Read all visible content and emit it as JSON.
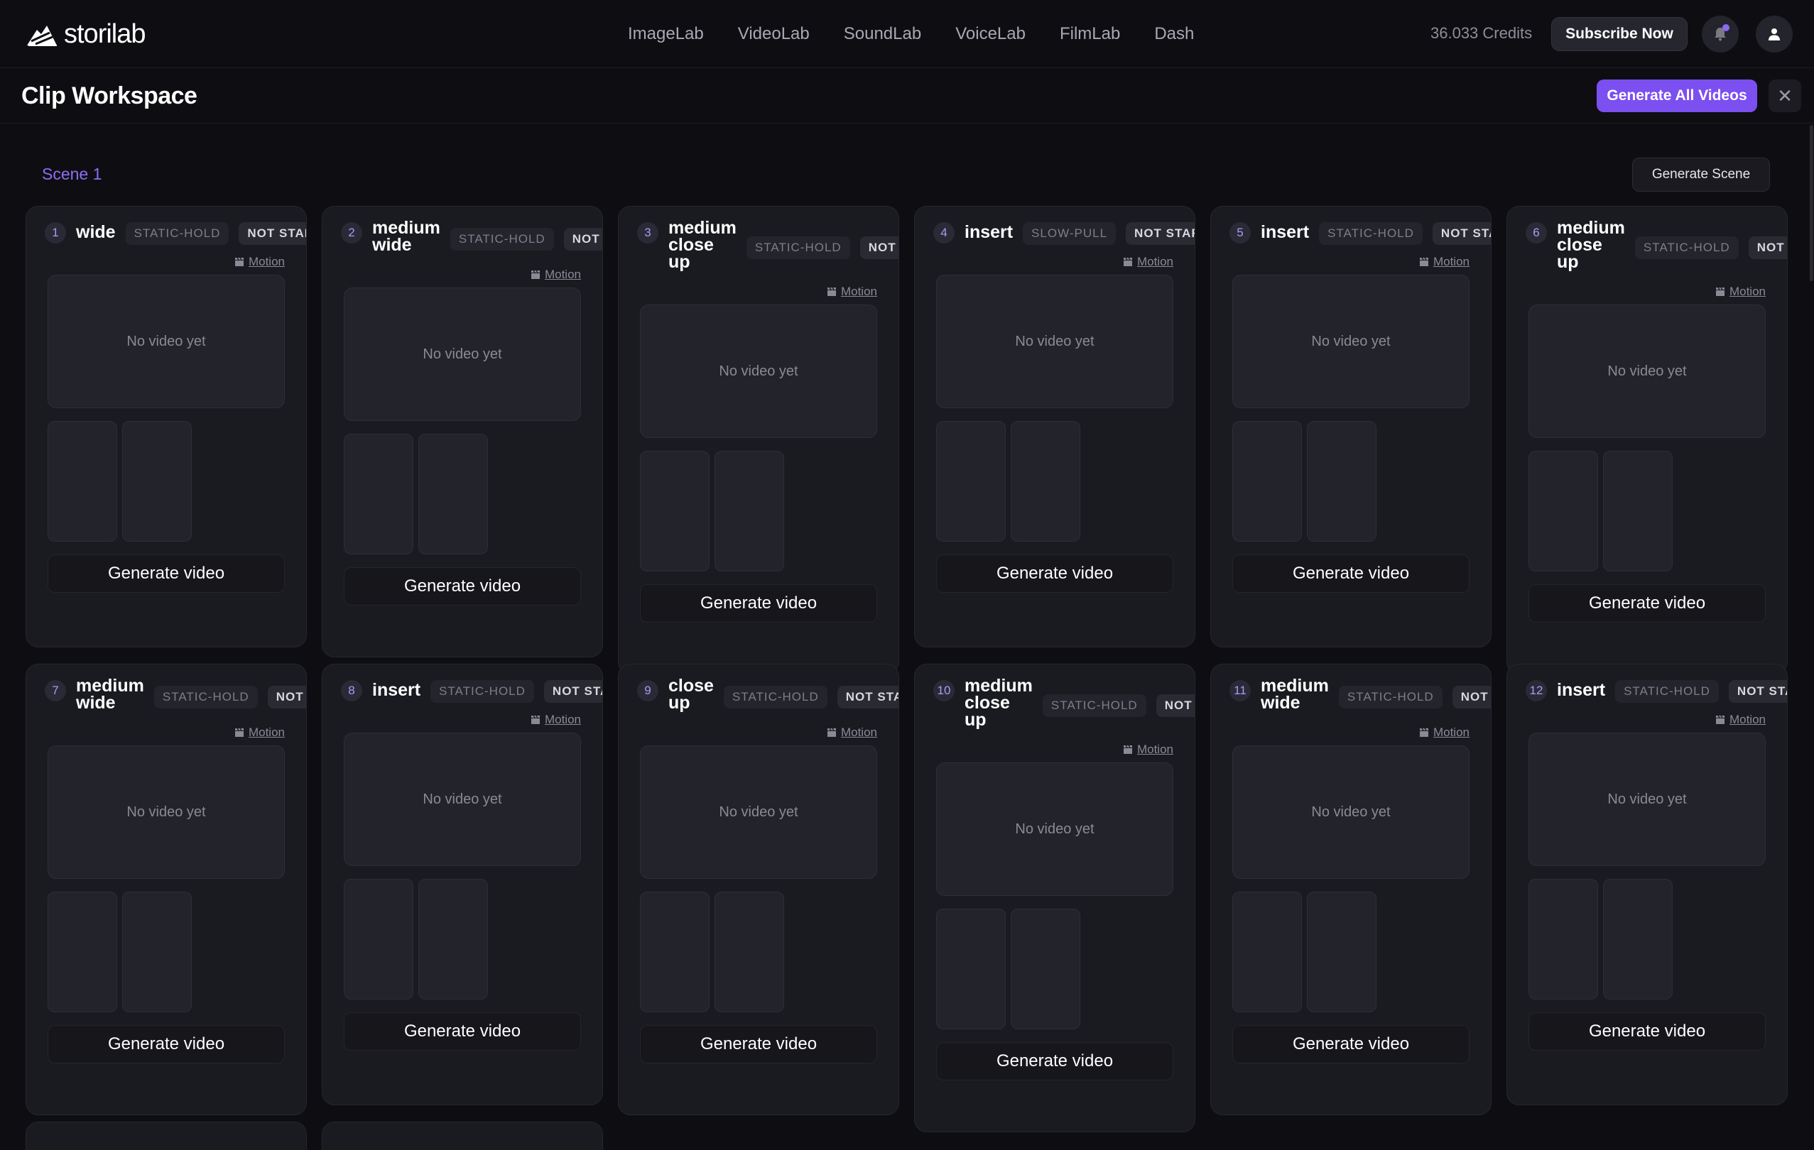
{
  "app": {
    "logo_text": "storilab",
    "nav": [
      "ImageLab",
      "VideoLab",
      "SoundLab",
      "VoiceLab",
      "FilmLab",
      "Dash"
    ],
    "credits": "36.033 Credits",
    "subscribe_label": "Subscribe Now"
  },
  "workspace": {
    "title": "Clip Workspace",
    "generate_all_label": "Generate All Videos",
    "close_glyph": "✕"
  },
  "scene": {
    "label": "Scene 1",
    "generate_scene_label": "Generate Scene"
  },
  "common": {
    "motion_label": "Motion",
    "no_video": "No video yet",
    "generate_label": "Generate video"
  },
  "clips": [
    {
      "num": "1",
      "shot": "wide",
      "motion": "STATIC-HOLD",
      "status": "NOT STARTED"
    },
    {
      "num": "2",
      "shot": "medium wide",
      "motion": "STATIC-HOLD",
      "status": "NOT STARTED"
    },
    {
      "num": "3",
      "shot": "medium close up",
      "motion": "STATIC-HOLD",
      "status": "NOT STARTED"
    },
    {
      "num": "4",
      "shot": "insert",
      "motion": "SLOW-PULL",
      "status": "NOT STARTED"
    },
    {
      "num": "5",
      "shot": "insert",
      "motion": "STATIC-HOLD",
      "status": "NOT STARTED"
    },
    {
      "num": "6",
      "shot": "medium close up",
      "motion": "STATIC-HOLD",
      "status": "NOT STARTED"
    },
    {
      "num": "7",
      "shot": "medium wide",
      "motion": "STATIC-HOLD",
      "status": "NOT STARTED"
    },
    {
      "num": "8",
      "shot": "insert",
      "motion": "STATIC-HOLD",
      "status": "NOT STARTED"
    },
    {
      "num": "9",
      "shot": "close up",
      "motion": "STATIC-HOLD",
      "status": "NOT STARTED"
    },
    {
      "num": "10",
      "shot": "medium close up",
      "motion": "STATIC-HOLD",
      "status": "NOT STARTED"
    },
    {
      "num": "11",
      "shot": "medium wide",
      "motion": "STATIC-HOLD",
      "status": "NOT STARTED"
    },
    {
      "num": "12",
      "shot": "insert",
      "motion": "STATIC-HOLD",
      "status": "NOT STARTED"
    }
  ],
  "colors": {
    "accent": "#7c4ff0",
    "scene_label": "#8f6df5",
    "background": "#0e0e12",
    "card": "#1a1a21"
  },
  "icons": [
    "logo-mark-icon",
    "bell-icon",
    "user-icon",
    "close-icon",
    "clapperboard-icon"
  ]
}
